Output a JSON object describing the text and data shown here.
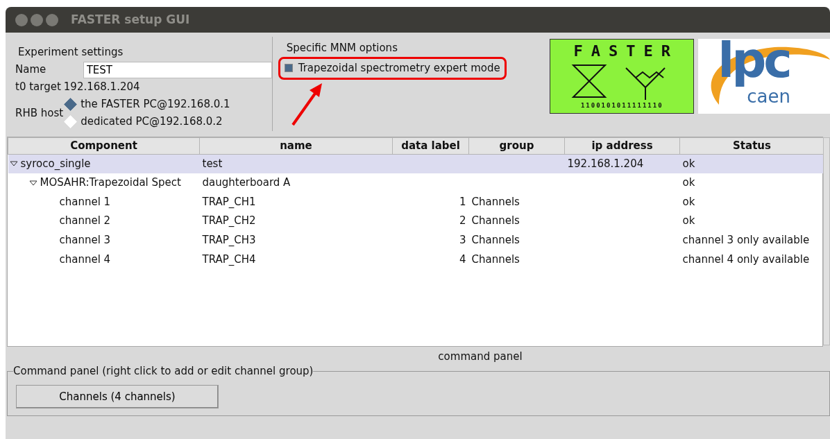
{
  "window": {
    "title": "FASTER setup GUI"
  },
  "experiment": {
    "title": "Experiment settings",
    "name_label": "Name",
    "name_value": "TEST",
    "t0_label": "t0 target",
    "t0_value": "192.168.1.204",
    "rhb_label": "RHB host",
    "rhb_options": [
      {
        "label": "the FASTER PC@192.168.0.1",
        "selected": true
      },
      {
        "label": "dedicated PC@192.168.0.2",
        "selected": false
      }
    ]
  },
  "mnm": {
    "title": "Specific MNM options",
    "option": {
      "label": "Trapezoidal spectrometry expert mode",
      "checked": true
    }
  },
  "faster_logo": {
    "word": "FASTER",
    "bits": "1100101011111110"
  },
  "lpc_logo": {
    "word": "lpc",
    "sub": "caen"
  },
  "table": {
    "columns": [
      "Component",
      "name",
      "data label",
      "group",
      "ip address",
      "Status"
    ],
    "rows": [
      {
        "cells": [
          "syroco_single",
          "test",
          "",
          "",
          "192.168.1.204",
          "ok"
        ],
        "expanded": true,
        "selected": true,
        "children": [
          {
            "cells": [
              "MOSAHR:Trapezoidal Spect",
              "daughterboard A",
              "",
              "",
              "",
              "ok"
            ],
            "expanded": true,
            "selected": false,
            "children": [
              {
                "cells": [
                  "channel 1",
                  "TRAP_CH1",
                  "1",
                  "Channels",
                  "",
                  "ok"
                ],
                "selected": false
              },
              {
                "cells": [
                  "channel 2",
                  "TRAP_CH2",
                  "2",
                  "Channels",
                  "",
                  "ok"
                ],
                "selected": false
              },
              {
                "cells": [
                  "channel 3",
                  "TRAP_CH3",
                  "3",
                  "Channels",
                  "",
                  "channel 3 only available"
                ],
                "selected": false
              },
              {
                "cells": [
                  "channel 4",
                  "TRAP_CH4",
                  "4",
                  "Channels",
                  "",
                  "channel 4 only available"
                ],
                "selected": false
              }
            ]
          }
        ]
      }
    ]
  },
  "command_panel": {
    "title": "command panel",
    "legend": "Command panel (right click to add or edit channel group)",
    "buttons": [
      "Channels (4 channels)"
    ]
  }
}
